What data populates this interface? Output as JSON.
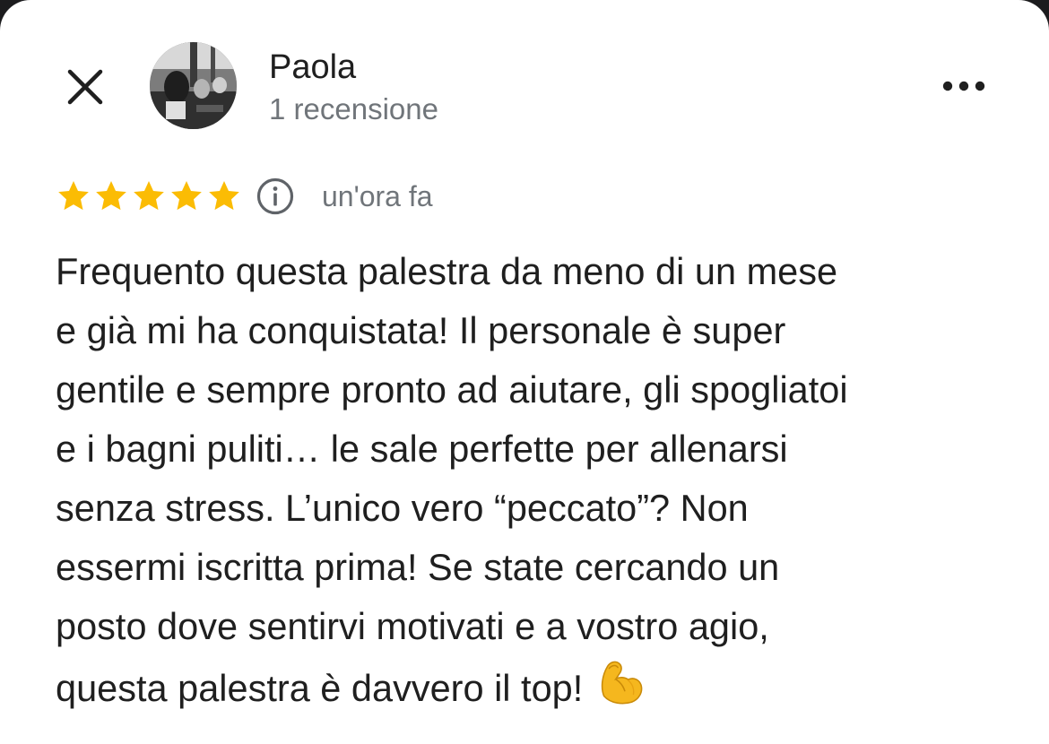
{
  "reviewer": {
    "name": "Paola",
    "subtitle": "1 recensione"
  },
  "rating": {
    "stars": 5,
    "max_stars": 5,
    "star_color": "#fbbc04",
    "time_ago": "un'ora fa"
  },
  "review": {
    "text": "Frequento questa palestra da meno di un mese\ne già mi ha conquistata! Il personale è super\ngentile e sempre pronto ad aiutare, gli spogliatoi\ne i bagni puliti… le sale perfette per allenarsi\nsenza stress. L’unico vero “peccato”? Non\nessermi iscritta prima! Se state cercando un\nposto dove sentirvi motivati e a vostro agio,\nquesta palestra è davvero il top!",
    "emoji": "flexed-biceps-emoji"
  },
  "icons": {
    "close": "close-icon",
    "more": "more-horizontal-icon",
    "info": "info-icon",
    "star": "star-icon"
  }
}
